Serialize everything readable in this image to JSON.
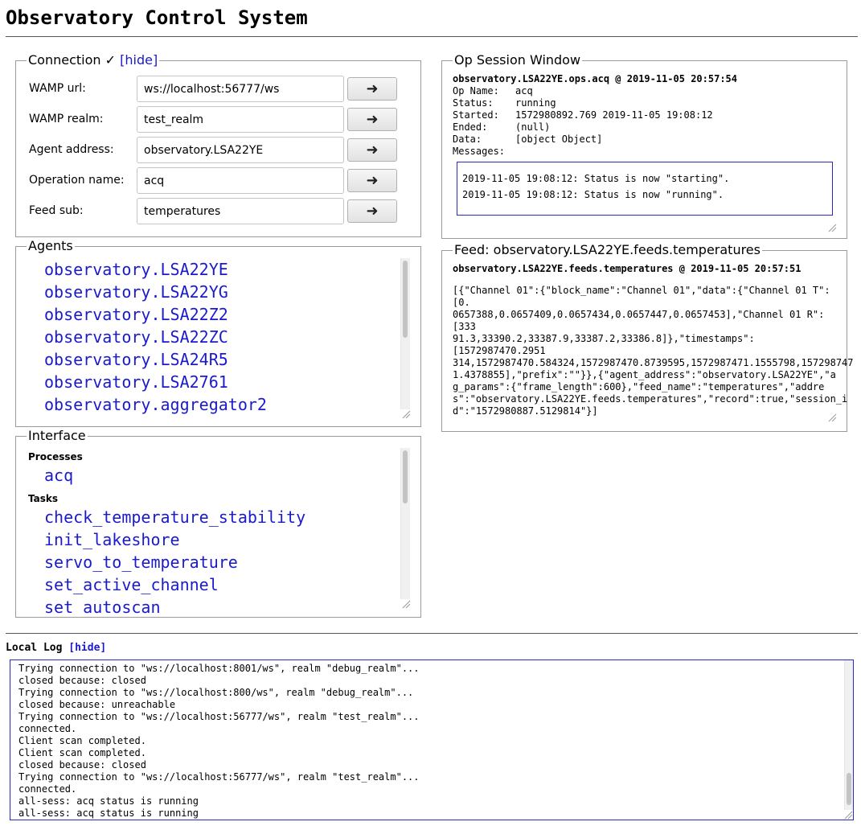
{
  "app": {
    "title": "Observatory Control System"
  },
  "connection": {
    "legend": "Connection ✓",
    "hide_label": "[hide]",
    "rows": [
      {
        "label": "WAMP url:",
        "value": "ws://localhost:56777/ws"
      },
      {
        "label": "WAMP realm:",
        "value": "test_realm"
      },
      {
        "label": "Agent address:",
        "value": "observatory.LSA22YE"
      },
      {
        "label": "Operation name:",
        "value": "acq"
      },
      {
        "label": "Feed sub:",
        "value": "temperatures"
      }
    ],
    "go_glyph": "➜"
  },
  "agents": {
    "legend": "Agents",
    "items": [
      "observatory.LSA22YE",
      "observatory.LSA22YG",
      "observatory.LSA22Z2",
      "observatory.LSA22ZC",
      "observatory.LSA24R5",
      "observatory.LSA2761",
      "observatory.aggregator2"
    ]
  },
  "interface": {
    "legend": "Interface",
    "processes_label": "Processes",
    "processes": [
      "acq"
    ],
    "tasks_label": "Tasks",
    "tasks": [
      "check_temperature_stability",
      "init_lakeshore",
      "servo_to_temperature",
      "set_active_channel",
      "set_autoscan"
    ]
  },
  "op_session": {
    "legend": "Op Session Window",
    "header": "observatory.LSA22YE.ops.acq @ 2019-11-05 20:57:54",
    "fields": [
      {
        "key": "Op Name:",
        "value": "acq"
      },
      {
        "key": "Status:",
        "value": "running"
      },
      {
        "key": "Started:",
        "value": "1572980892.769 2019-11-05 19:08:12"
      },
      {
        "key": "Ended:",
        "value": "(null)"
      },
      {
        "key": "Data:",
        "value": "[object Object]"
      },
      {
        "key": "Messages:",
        "value": ""
      }
    ],
    "messages": [
      "2019-11-05 19:08:12: Status is now \"starting\".",
      "2019-11-05 19:08:12: Status is now \"running\"."
    ]
  },
  "feed": {
    "legend": "Feed: observatory.LSA22YE.feeds.temperatures",
    "header": "observatory.LSA22YE.feeds.temperatures @ 2019-11-05 20:57:51",
    "lines": [
      "[{\"Channel 01\":{\"block_name\":\"Channel 01\",\"data\":{\"Channel 01 T\":[0.",
      "0657388,0.0657409,0.0657434,0.0657447,0.0657453],\"Channel 01 R\":[333",
      "91.3,33390.2,33387.9,33387.2,33386.8]},\"timestamps\":[1572987470.2951",
      "314,1572987470.584324,1572987470.8739595,1572987471.1555798,157298747",
      "1.4378855],\"prefix\":\"\"}},{\"agent_address\":\"observatory.LSA22YE\",\"a",
      "g_params\":{\"frame_length\":600},\"feed_name\":\"temperatures\",\"addre",
      "s\":\"observatory.LSA22YE.feeds.temperatures\",\"record\":true,\"session_i",
      "d\":\"1572980887.5129814\"}]"
    ]
  },
  "local_log": {
    "title": "Local Log",
    "hide_label": "[hide]",
    "lines": [
      "Trying connection to \"ws://localhost:8001/ws\", realm \"debug_realm\"...",
      "closed because: closed",
      "Trying connection to \"ws://localhost:800/ws\", realm \"debug_realm\"...",
      "closed because: unreachable",
      "Trying connection to \"ws://localhost:56777/ws\", realm \"test_realm\"...",
      "connected.",
      "Client scan completed.",
      "Client scan completed.",
      "closed because: closed",
      "Trying connection to \"ws://localhost:56777/ws\", realm \"test_realm\"...",
      "connected.",
      "all-sess: acq status is running",
      "all-sess: acq status is running"
    ]
  },
  "icons": {
    "arrow": "arrow-right-icon",
    "resize": "resize-grip-icon"
  }
}
